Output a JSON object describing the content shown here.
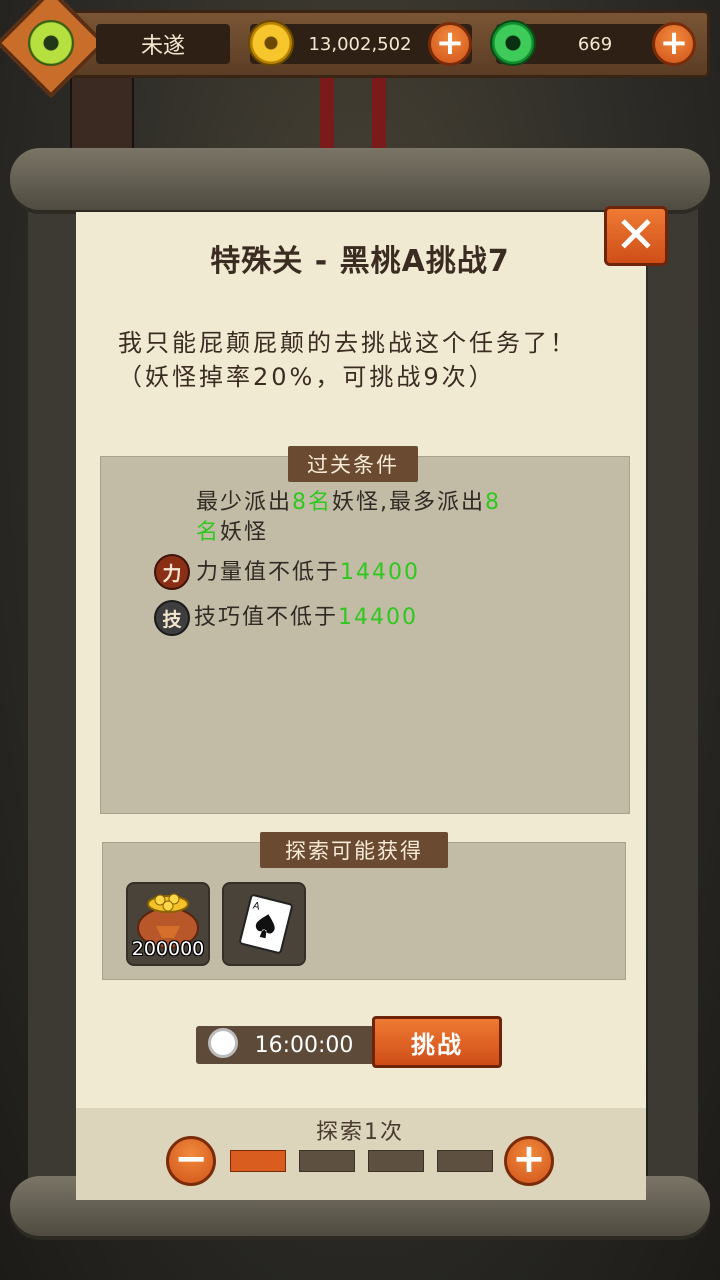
{
  "player": {
    "name": "未遂"
  },
  "currency": {
    "coins": "13,002,502",
    "jade": "669"
  },
  "dialog": {
    "title": "特殊关 - 黑桃A挑战7",
    "description": "我只能屁颠屁颠的去挑战这个任务了！（妖怪掉率20%，可挑战9次）",
    "conditions": {
      "header": "过关条件",
      "dispatch": {
        "pre1": "最少派出",
        "num1": "8名",
        "mid": "妖怪,最多派出",
        "num2": "8",
        "line2a": "名",
        "line2b": "妖怪"
      },
      "power": {
        "icon_char": "力",
        "label": "力量值不低于",
        "value": "14400"
      },
      "skill": {
        "icon_char": "技",
        "label": "技巧值不低于",
        "value": "14400"
      }
    },
    "rewards": {
      "header": "探索可能获得",
      "items": [
        {
          "icon": "coin-bag-icon",
          "count": "200000"
        },
        {
          "icon": "spade-ace-card-icon",
          "count": ""
        }
      ]
    },
    "timer": "16:00:00",
    "challenge_label": "挑战",
    "explore_count": "探索1次",
    "explore_level": 1,
    "explore_max": 4
  },
  "colors": {
    "accent_orange": "#d95d1f",
    "highlight_green": "#2fc81e",
    "panel": "#f1ead3"
  }
}
